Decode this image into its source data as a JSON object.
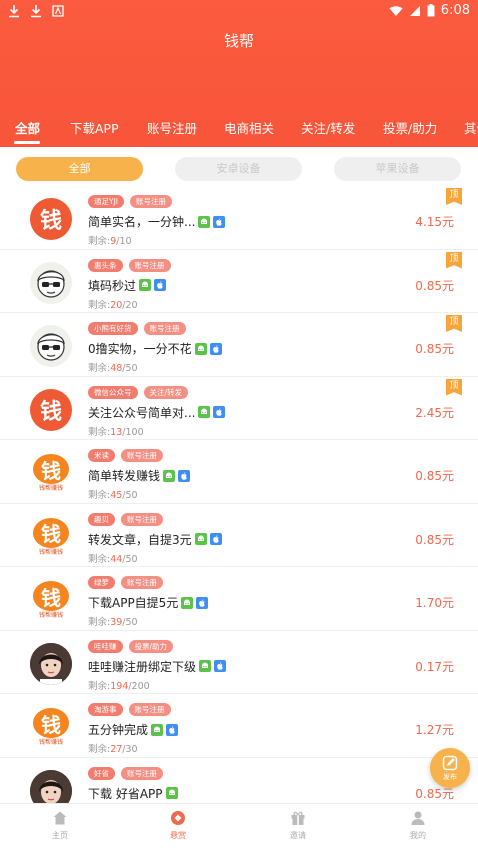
{
  "status": {
    "time": "6:08"
  },
  "title": "钱帮",
  "tabs": [
    "全部",
    "下载APP",
    "账号注册",
    "电商相关",
    "关注/转发",
    "投票/助力",
    "其他"
  ],
  "segments": [
    "全部",
    "安卓设备",
    "苹果设备"
  ],
  "remain_label": "剩余:",
  "tasks": [
    {
      "tags": [
        "通足YJI",
        "账号注册"
      ],
      "name": "简单实名，一分钟...",
      "platforms": [
        "android",
        "ios"
      ],
      "left": "9",
      "total": "10",
      "price": "4.15元",
      "top": "顶",
      "avatar": "qian-red"
    },
    {
      "tags": [
        "惠头条",
        "账号注册"
      ],
      "name": "填码秒过",
      "platforms": [
        "android",
        "ios"
      ],
      "left": "20",
      "total": "20",
      "price": "0.85元",
      "top": "顶",
      "avatar": "cartoon"
    },
    {
      "tags": [
        "小熊有好货",
        "账号注册"
      ],
      "name": "0撸实物，一分不花",
      "platforms": [
        "android",
        "ios"
      ],
      "left": "48",
      "total": "50",
      "price": "0.85元",
      "top": "顶",
      "avatar": "cartoon"
    },
    {
      "tags": [
        "微信公众号",
        "关注/转发"
      ],
      "name": "关注公众号简单对...",
      "platforms": [
        "android",
        "ios"
      ],
      "left": "13",
      "total": "100",
      "price": "2.45元",
      "top": "顶",
      "avatar": "qian-red"
    },
    {
      "tags": [
        "米读",
        "账号注册"
      ],
      "name": "简单转发赚钱",
      "platforms": [
        "android",
        "ios"
      ],
      "left": "45",
      "total": "50",
      "price": "0.85元",
      "top": "",
      "avatar": "qian-orange"
    },
    {
      "tags": [
        "趣贝",
        "账号注册"
      ],
      "name": "转发文章，自提3元",
      "platforms": [
        "android",
        "ios"
      ],
      "left": "44",
      "total": "50",
      "price": "0.85元",
      "top": "",
      "avatar": "qian-orange"
    },
    {
      "tags": [
        "绿萝",
        "账号注册"
      ],
      "name": "下载APP自提5元",
      "platforms": [
        "android",
        "ios"
      ],
      "left": "39",
      "total": "50",
      "price": "1.70元",
      "top": "",
      "avatar": "qian-orange"
    },
    {
      "tags": [
        "哇哇赚",
        "投票/助力"
      ],
      "name": "哇哇赚注册绑定下级",
      "platforms": [
        "android",
        "ios"
      ],
      "left": "194",
      "total": "200",
      "price": "0.17元",
      "top": "",
      "avatar": "girl"
    },
    {
      "tags": [
        "淘游事",
        "账号注册"
      ],
      "name": "五分钟完成",
      "platforms": [
        "android",
        "ios"
      ],
      "left": "27",
      "total": "30",
      "price": "1.27元",
      "top": "",
      "avatar": "qian-orange"
    },
    {
      "tags": [
        "好省",
        "账号注册"
      ],
      "name": "下载 好省APP",
      "platforms": [
        "android"
      ],
      "left": "",
      "total": "",
      "price": "0.85元",
      "top": "",
      "avatar": "girl"
    }
  ],
  "qian_char": "钱",
  "qian_caption": "钱帮赚钱",
  "fab_label": "发布",
  "bottom_nav": [
    "主页",
    "悬赏",
    "邀请",
    "我的"
  ],
  "colors": {
    "header": "#f8553a",
    "accent": "#f0684d",
    "segment_active": "#f7b24b",
    "top_tag": "#f5a53a"
  }
}
